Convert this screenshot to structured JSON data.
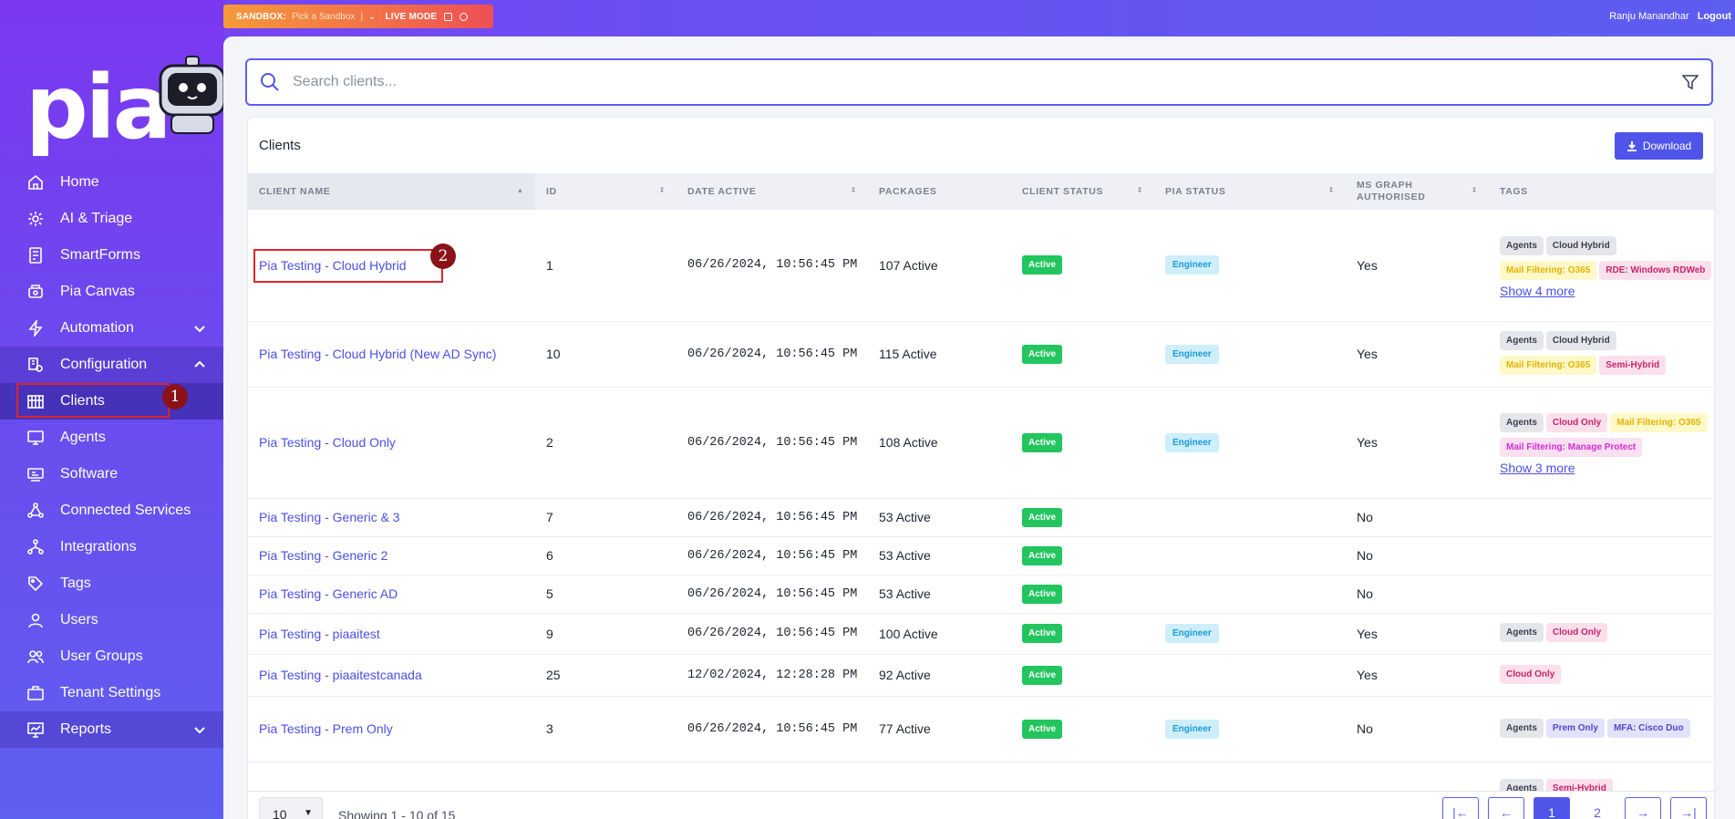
{
  "topbar": {
    "sandbox_label": "SANDBOX:",
    "sandbox_pick": "Pick a Sandbox",
    "live_mode": "LIVE MODE",
    "user_name": "Ranju Manandhar",
    "logout": "Logout"
  },
  "brand": {
    "logo_text": "pia"
  },
  "sidebar": {
    "items": [
      {
        "label": "Home",
        "icon": "home-icon"
      },
      {
        "label": "AI & Triage",
        "icon": "ai-icon"
      },
      {
        "label": "SmartForms",
        "icon": "form-icon"
      },
      {
        "label": "Pia Canvas",
        "icon": "canvas-icon"
      },
      {
        "label": "Automation",
        "icon": "lightning-icon"
      },
      {
        "label": "Configuration",
        "icon": "config-icon"
      },
      {
        "label": "Clients",
        "icon": "building-icon"
      },
      {
        "label": "Agents",
        "icon": "monitor-icon"
      },
      {
        "label": "Software",
        "icon": "software-icon"
      },
      {
        "label": "Connected Services",
        "icon": "network-icon"
      },
      {
        "label": "Integrations",
        "icon": "integration-icon"
      },
      {
        "label": "Tags",
        "icon": "tag-icon"
      },
      {
        "label": "Users",
        "icon": "user-icon"
      },
      {
        "label": "User Groups",
        "icon": "users-icon"
      },
      {
        "label": "Tenant Settings",
        "icon": "settings-icon"
      },
      {
        "label": "Reports",
        "icon": "reports-icon"
      }
    ]
  },
  "annotations": {
    "step1": "1",
    "step2": "2"
  },
  "search": {
    "placeholder": "Search clients..."
  },
  "clients": {
    "title": "Clients",
    "download_label": "Download",
    "columns": [
      "CLIENT NAME",
      "ID",
      "DATE ACTIVE",
      "PACKAGES",
      "CLIENT STATUS",
      "PIA STATUS",
      "MS GRAPH AUTHORISED",
      "TAGS"
    ],
    "rows": [
      {
        "name": "Pia Testing - Cloud Hybrid",
        "id": "1",
        "date": "06/26/2024, 10:56:45 PM",
        "packages": "107 Active",
        "status": "Active",
        "pia": "Engineer",
        "ms": "Yes",
        "tags": [
          {
            "t": "Agents",
            "c": "gray"
          },
          {
            "t": "Cloud Hybrid",
            "c": "gray"
          },
          {
            "t": "Mail Filtering: O365",
            "c": "yellow"
          },
          {
            "t": "RDE: Windows RDWeb",
            "c": "pink"
          }
        ],
        "more": "Show 4 more"
      },
      {
        "name": "Pia Testing - Cloud Hybrid (New AD Sync)",
        "id": "10",
        "date": "06/26/2024, 10:56:45 PM",
        "packages": "115 Active",
        "status": "Active",
        "pia": "Engineer",
        "ms": "Yes",
        "tags": [
          {
            "t": "Agents",
            "c": "gray"
          },
          {
            "t": "Cloud Hybrid",
            "c": "gray"
          },
          {
            "t": "Mail Filtering: O365",
            "c": "yellow"
          },
          {
            "t": "Semi-Hybrid",
            "c": "pink"
          }
        ],
        "more": ""
      },
      {
        "name": "Pia Testing - Cloud Only",
        "id": "2",
        "date": "06/26/2024, 10:56:45 PM",
        "packages": "108 Active",
        "status": "Active",
        "pia": "Engineer",
        "ms": "Yes",
        "tags": [
          {
            "t": "Agents",
            "c": "gray"
          },
          {
            "t": "Cloud Only",
            "c": "pink"
          },
          {
            "t": "Mail Filtering: O365",
            "c": "yellow"
          },
          {
            "t": "Mail Filtering: Manage Protect",
            "c": "magenta"
          }
        ],
        "more": "Show 3 more"
      },
      {
        "name": "Pia Testing - Generic & 3",
        "id": "7",
        "date": "06/26/2024, 10:56:45 PM",
        "packages": "53 Active",
        "status": "Active",
        "pia": "",
        "ms": "No",
        "tags": [],
        "more": ""
      },
      {
        "name": "Pia Testing - Generic 2",
        "id": "6",
        "date": "06/26/2024, 10:56:45 PM",
        "packages": "53 Active",
        "status": "Active",
        "pia": "",
        "ms": "No",
        "tags": [],
        "more": ""
      },
      {
        "name": "Pia Testing - Generic AD",
        "id": "5",
        "date": "06/26/2024, 10:56:45 PM",
        "packages": "53 Active",
        "status": "Active",
        "pia": "",
        "ms": "No",
        "tags": [],
        "more": ""
      },
      {
        "name": "Pia Testing - piaaitest",
        "id": "9",
        "date": "06/26/2024, 10:56:45 PM",
        "packages": "100 Active",
        "status": "Active",
        "pia": "Engineer",
        "ms": "Yes",
        "tags": [
          {
            "t": "Agents",
            "c": "gray"
          },
          {
            "t": "Cloud Only",
            "c": "pink"
          }
        ],
        "more": ""
      },
      {
        "name": "Pia Testing - piaaitestcanada",
        "id": "25",
        "date": "12/02/2024, 12:28:28 PM",
        "packages": "92 Active",
        "status": "Active",
        "pia": "",
        "ms": "Yes",
        "tags": [
          {
            "t": "Cloud Only",
            "c": "pink"
          }
        ],
        "more": ""
      },
      {
        "name": "Pia Testing - Prem Only",
        "id": "3",
        "date": "06/26/2024, 10:56:45 PM",
        "packages": "77 Active",
        "status": "Active",
        "pia": "Engineer",
        "ms": "No",
        "tags": [
          {
            "t": "Agents",
            "c": "gray"
          },
          {
            "t": "Prem Only",
            "c": "lilac"
          },
          {
            "t": "MFA: Cisco Duo",
            "c": "lilac"
          }
        ],
        "more": ""
      },
      {
        "name": "",
        "id": "",
        "date": "",
        "packages": "",
        "status": "",
        "pia": "",
        "ms": "",
        "tags": [
          {
            "t": "Agents",
            "c": "gray"
          },
          {
            "t": "Semi-Hybrid",
            "c": "pink"
          }
        ],
        "more": ""
      }
    ]
  },
  "pagination": {
    "page_size": "10",
    "showing": "Showing 1 - 10 of 15",
    "pages": [
      "1",
      "2"
    ],
    "current": "1",
    "first": "|←",
    "prev": "←",
    "next": "→",
    "last": "→|"
  },
  "colors": {
    "accent": "#4f55e8",
    "active_badge": "#22c55e",
    "engineer_badge": "#cfeefc",
    "annotation_red": "#d9262b"
  }
}
